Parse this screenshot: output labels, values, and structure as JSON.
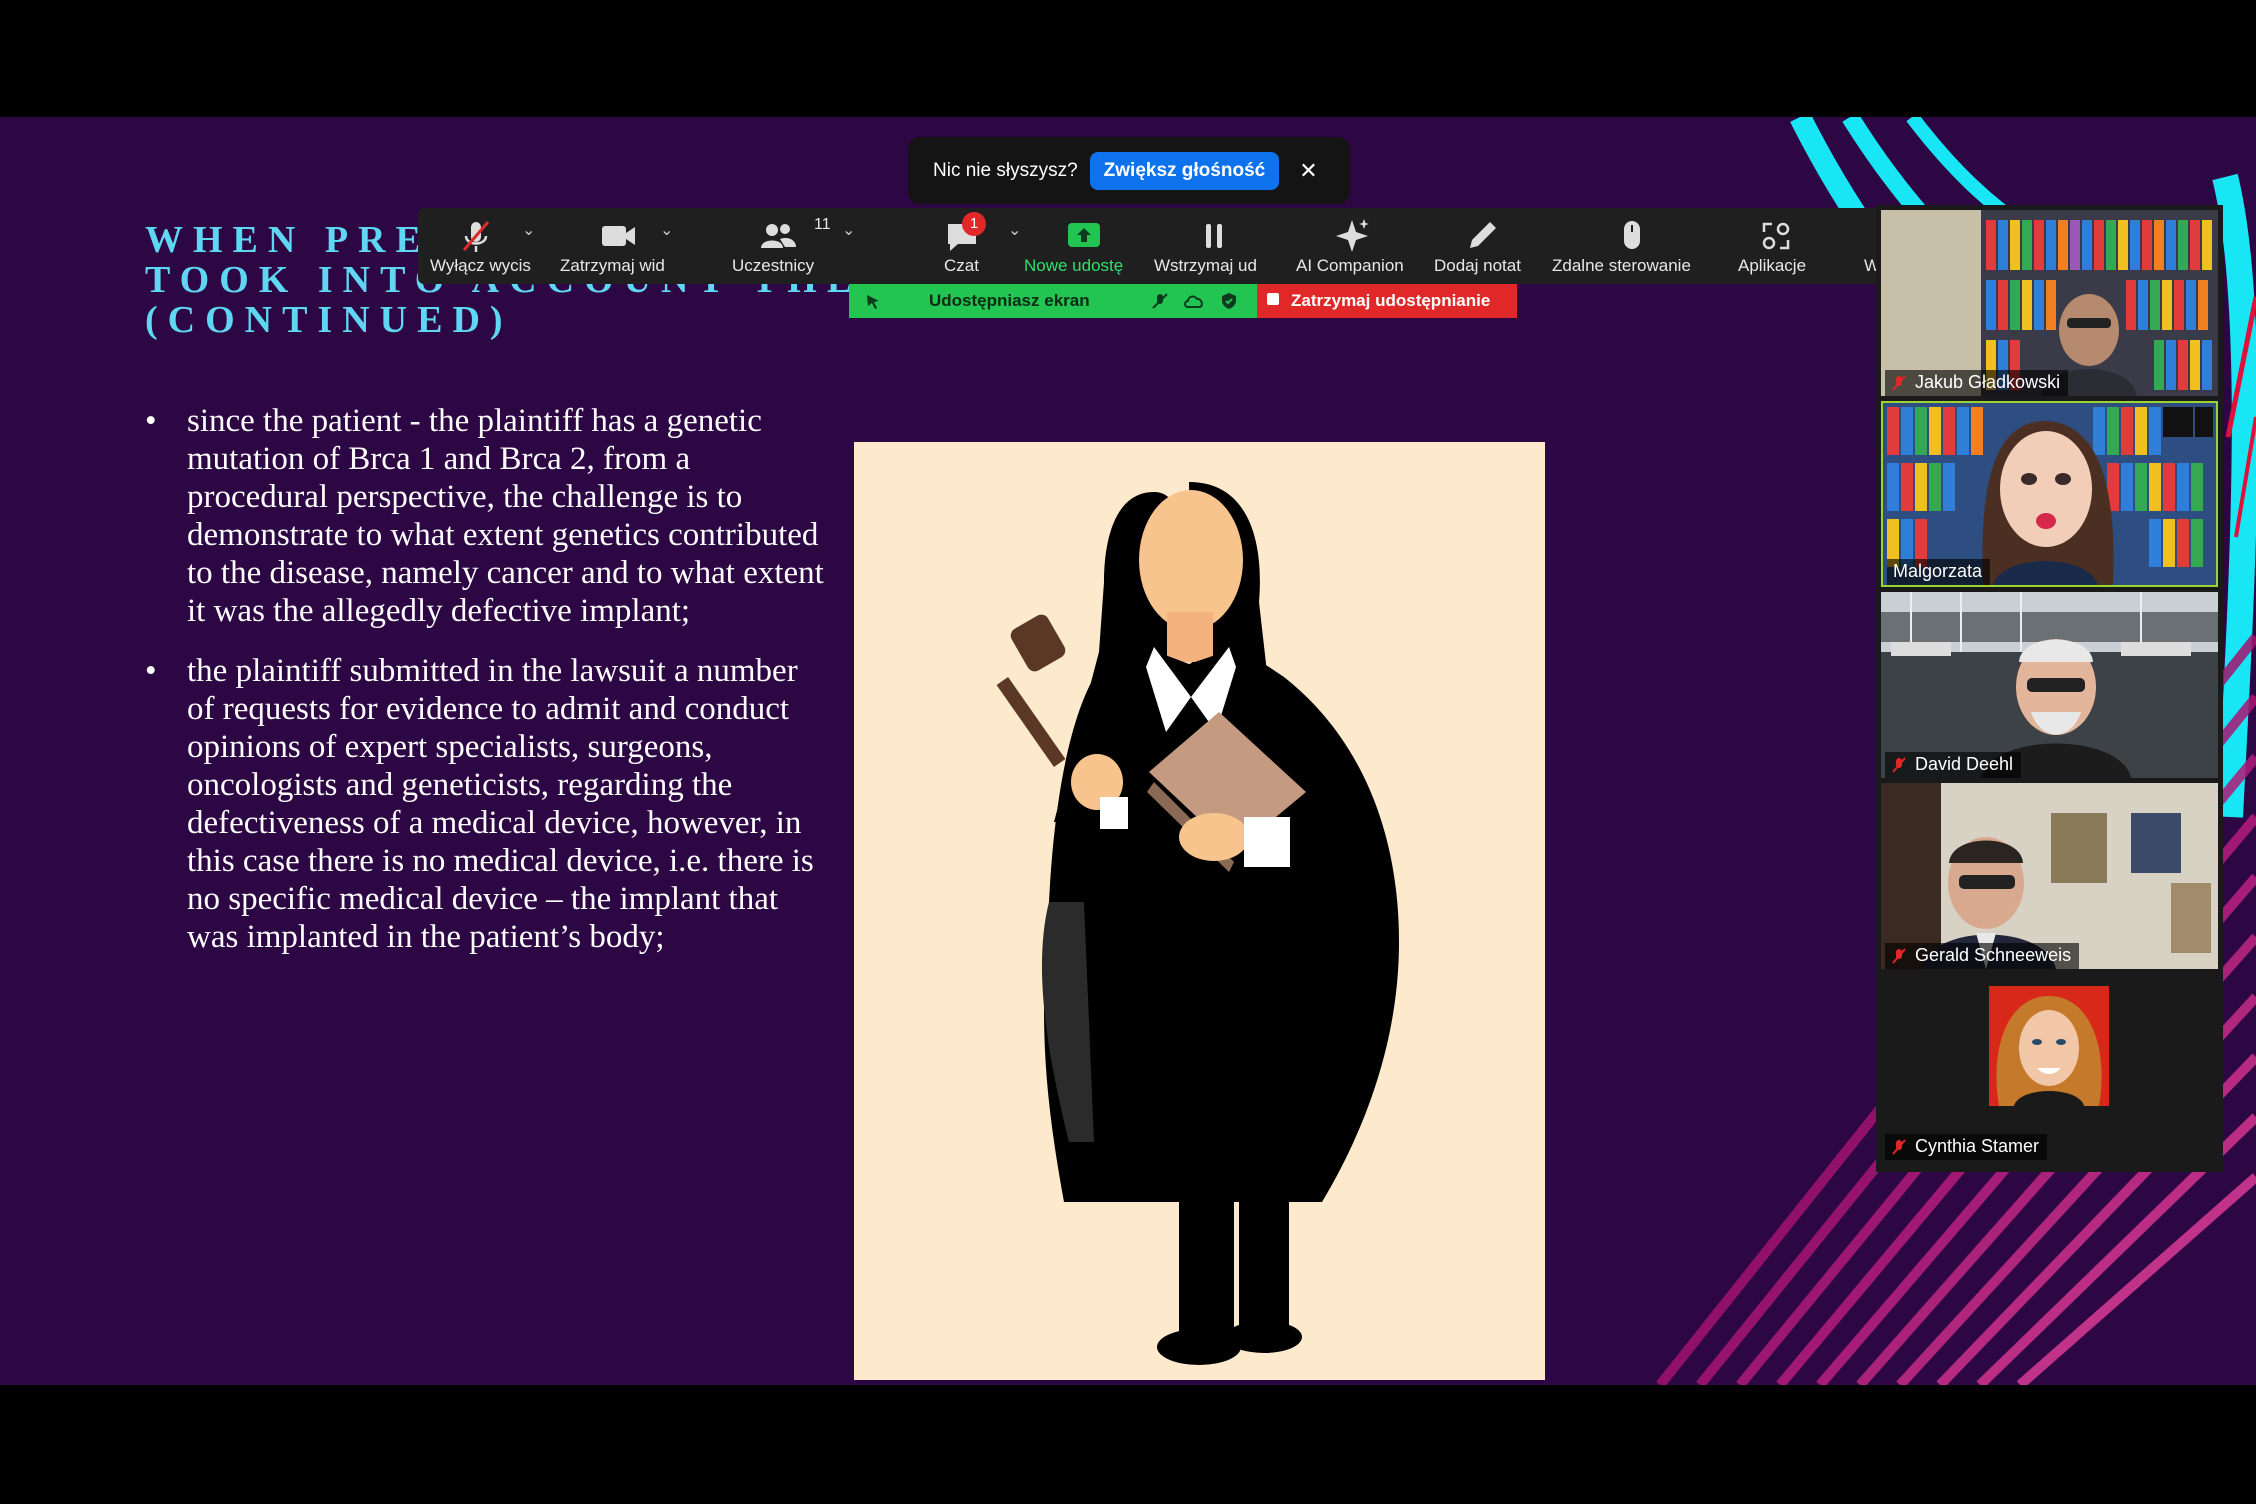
{
  "slide": {
    "title_lines": [
      "WHEN PRE",
      "TOOK INTO ACCOUNT THE",
      "(CONTINUED)"
    ],
    "bullet_char": "•",
    "bullets": [
      "since the patient - the plaintiff has a genetic mutation of Brca 1 and Brca 2, from a procedural perspective, the challenge is to demonstrate to what extent genetics contributed to the disease, namely cancer and to what extent it was the allegedly defective implant;",
      "the plaintiff submitted in the lawsuit a number of requests for evidence to admit and conduct opinions of expert specialists, surgeons, oncologists and geneticists, regarding the defectiveness of a medical device, however, in this case there is no medical device, i.e. there is no specific medical device – the implant that was implanted in the patient’s body;"
    ]
  },
  "toast": {
    "message": "Nic nie słyszysz?",
    "button_label": "Zwiększ głośność",
    "close_glyph": "✕"
  },
  "toolbar": {
    "mute_label": "Wyłącz wycis",
    "video_label": "Zatrzymaj wid",
    "participants_label": "Uczestnicy",
    "participants_count": "11",
    "chat_label": "Czat",
    "chat_badge": "1",
    "new_share_label": "Nowe udostę",
    "pause_label": "Wstrzymaj ud",
    "ai_label": "AI Companion",
    "annotate_label": "Dodaj notat",
    "remote_label": "Zdalne sterowanie",
    "apps_label": "Aplikacje",
    "more_label": "Więcej",
    "chevron": "⌄"
  },
  "share_bar": {
    "sharing_label": "Udostępniasz ekran",
    "stop_label": "Zatrzymaj udostępnianie"
  },
  "participants": [
    {
      "name": "Jakub Gładkowski",
      "muted": true
    },
    {
      "name": "Malgorzata",
      "muted": false
    },
    {
      "name": "David Deehl",
      "muted": true
    },
    {
      "name": "Gerald Schneeweis",
      "muted": true
    },
    {
      "name": "Cynthia Stamer",
      "muted": true
    }
  ],
  "colors": {
    "slide_bg": "#2d0644",
    "title": "#5fd6f2",
    "accent_cyan": "#19e6f5",
    "accent_magenta": "#c8156e",
    "toolbar_bg": "#1f1f1f",
    "share_green": "#23c552",
    "share_red": "#e02828",
    "zoom_blue": "#0e72ed",
    "active_speaker": "#9ad430"
  }
}
